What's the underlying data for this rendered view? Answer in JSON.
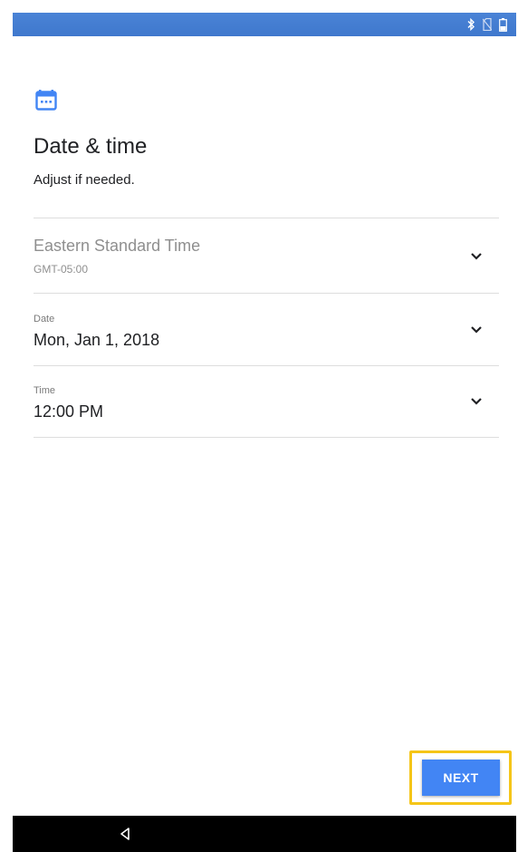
{
  "header": {
    "icon": "calendar-icon",
    "title": "Date & time",
    "subtitle": "Adjust if needed."
  },
  "settings": {
    "timezone": {
      "name": "Eastern Standard Time",
      "offset": "GMT-05:00"
    },
    "date": {
      "label": "Date",
      "value": "Mon, Jan 1, 2018"
    },
    "time": {
      "label": "Time",
      "value": "12:00 PM"
    }
  },
  "actions": {
    "next_label": "NEXT"
  },
  "colors": {
    "status_bar": "#3f78cd",
    "accent": "#4285f4",
    "highlight": "#f5c518",
    "nav_bar": "#000000"
  },
  "status_icons": [
    "bluetooth-icon",
    "no-sim-icon",
    "battery-icon"
  ]
}
